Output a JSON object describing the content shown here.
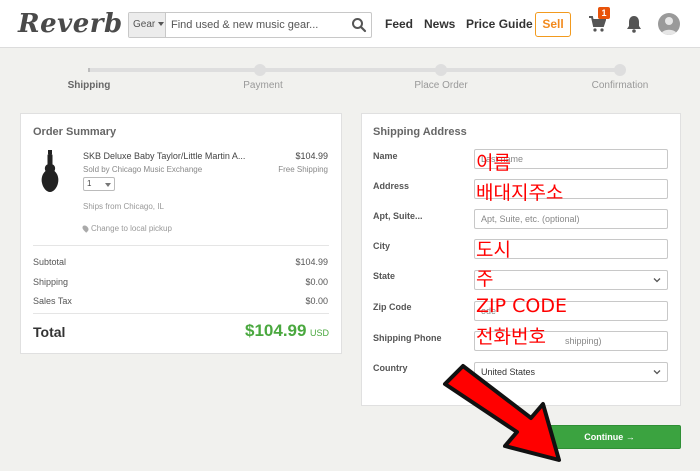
{
  "header": {
    "logo": "Reverb",
    "search_category": "Gear",
    "search_placeholder": "Find used & new music gear...",
    "nav": [
      "Feed",
      "News",
      "Price Guide"
    ],
    "sell_label": "Sell",
    "cart_count": "1"
  },
  "steps": [
    {
      "label": "Shipping",
      "active": true
    },
    {
      "label": "Payment",
      "active": false
    },
    {
      "label": "Place Order",
      "active": false
    },
    {
      "label": "Confirmation",
      "active": false
    }
  ],
  "order_summary": {
    "title": "Order Summary",
    "item": {
      "name": "SKB Deluxe Baby Taylor/Little Martin A...",
      "price": "$104.99",
      "seller": "Sold by Chicago Music Exchange",
      "shipping": "Free Shipping",
      "qty": "1",
      "ships_from": "Ships from Chicago, IL",
      "local_pickup": "Change to local pickup"
    },
    "subtotal_label": "Subtotal",
    "subtotal": "$104.99",
    "shipping_label": "Shipping",
    "shipping": "$0.00",
    "tax_label": "Sales Tax",
    "tax": "$0.00",
    "total_label": "Total",
    "total": "$104.99",
    "currency": "USD"
  },
  "shipping_address": {
    "title": "Shipping Address",
    "labels": {
      "name": "Name",
      "address": "Address",
      "apt": "Apt, Suite...",
      "city": "City",
      "state": "State",
      "zip": "Zip Code",
      "phone": "Shipping Phone",
      "country": "Country"
    },
    "name_placeholder": "Last name",
    "apt_placeholder": "Apt, Suite, etc. (optional)",
    "zip_placeholder": "ode",
    "phone_placeholder": "shipping)",
    "country_value": "United States"
  },
  "overlay": {
    "name": "이름",
    "address": "배대지주소",
    "city": "도시",
    "state": "주",
    "zip": "ZIP CODE",
    "phone": "전화번호"
  },
  "continue_label": "Continue →",
  "colors": {
    "accent_green": "#3ba340",
    "sell_orange": "#f28a1e",
    "annotation_red": "#ff0000"
  }
}
